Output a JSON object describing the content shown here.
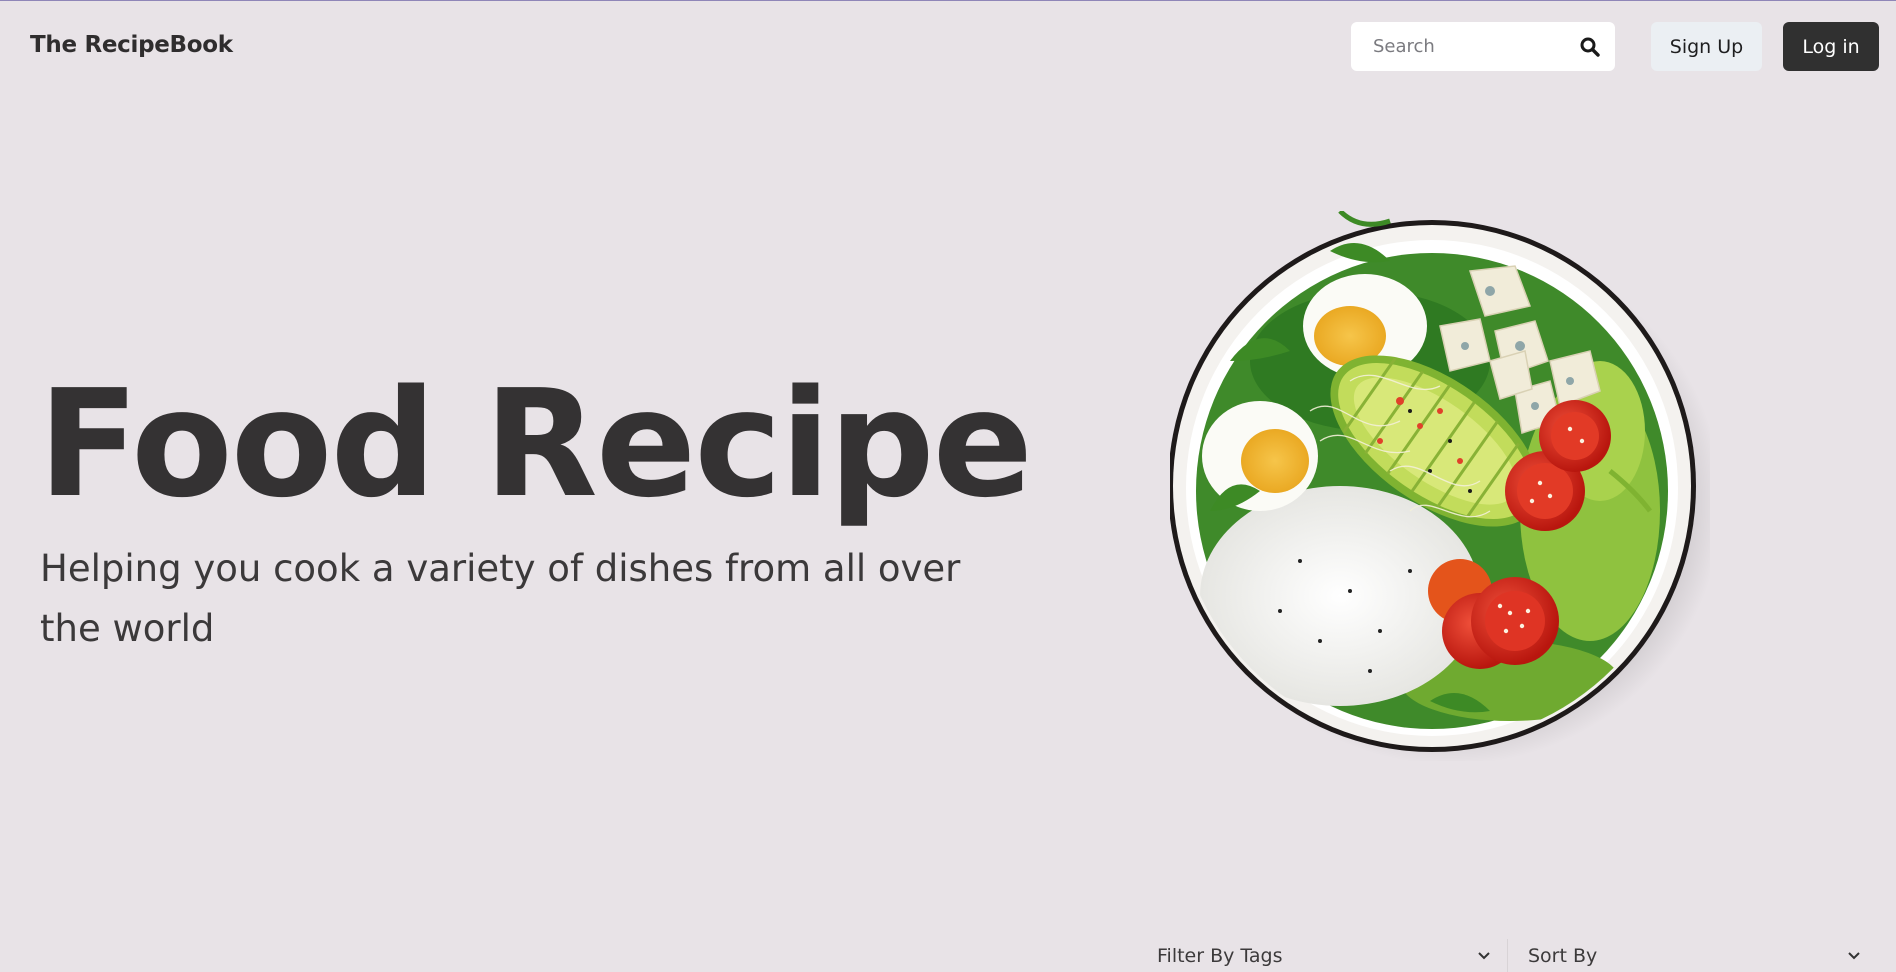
{
  "nav": {
    "brand": "The RecipeBook",
    "search": {
      "placeholder": "Search",
      "value": ""
    },
    "icons": {
      "search": "search-icon"
    },
    "signup_label": "Sign Up",
    "login_label": "Log in"
  },
  "hero": {
    "title": "Food Recipe",
    "subtitle": "Helping you cook a variety of dishes from all over the world",
    "image": "salad-bowl-image"
  },
  "filters": {
    "tags_label": "Filter By Tags",
    "sort_label": "Sort By",
    "icons": {
      "dropdown": "chevron-down-icon"
    }
  },
  "colors": {
    "background": "#e8e3e7",
    "text": "#343233",
    "login_bg": "#303030",
    "signup_bg": "#ebeff3"
  }
}
